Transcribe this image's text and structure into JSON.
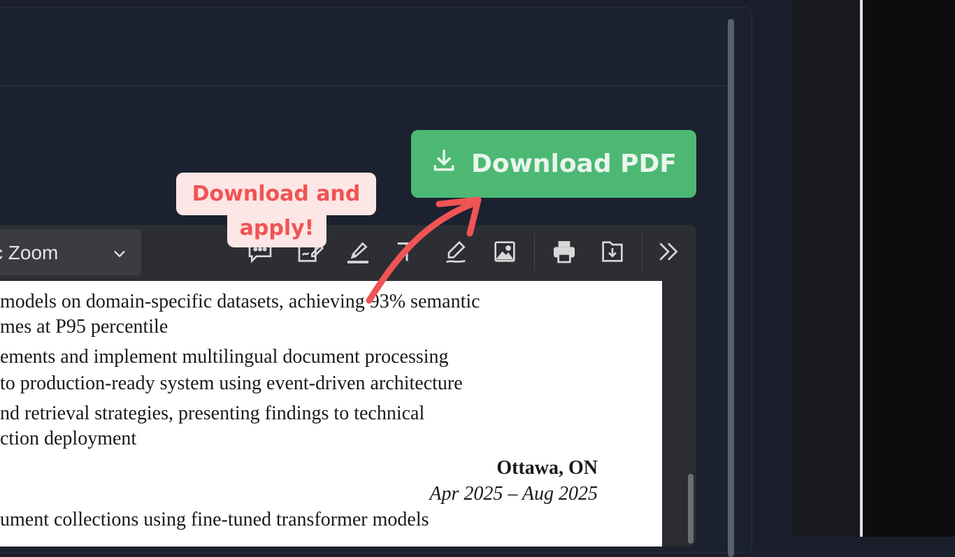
{
  "download_button": {
    "label": "Download PDF",
    "icon": "download-icon",
    "color": "#4cb874"
  },
  "callout": {
    "line1": "Download and",
    "line2": "apply!",
    "text_color": "#f05454",
    "bg_color": "#fde6e6"
  },
  "toolbar": {
    "zoom_value": "c Zoom",
    "tools": [
      "comment-icon",
      "signature-icon",
      "highlight-icon",
      "text-icon",
      "draw-icon",
      "image-icon",
      "print-icon",
      "save-icon",
      "more-icon"
    ]
  },
  "document": {
    "lines": [
      "models on domain-specific datasets, achieving 93% semantic",
      "mes at P95 percentile",
      "ements and implement multilingual document processing",
      " to production-ready system using event-driven architecture",
      "nd retrieval strategies, presenting findings to technical",
      "ction deployment"
    ],
    "location": "Ottawa, ON",
    "dates": "Apr 2025 – Aug 2025",
    "last_line": "ument collections using fine-tuned transformer models"
  }
}
